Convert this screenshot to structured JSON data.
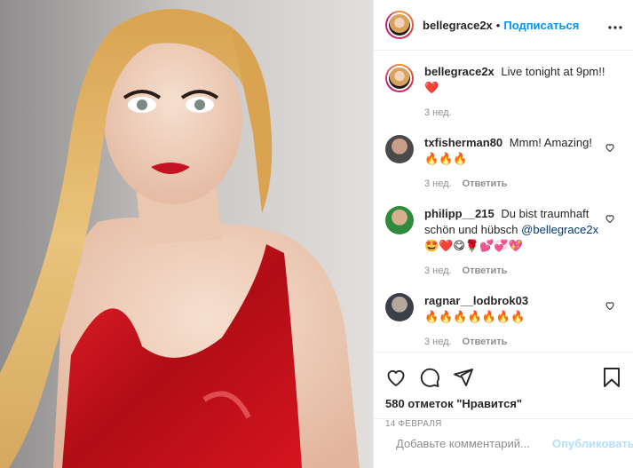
{
  "colors": {
    "accent": "#0095f6",
    "muted": "#8e8e8e",
    "heart": "#ed4956"
  },
  "header": {
    "username": "bellegrace2x",
    "separator": "•",
    "follow_label": "Подписаться",
    "more_icon": "more-options-icon"
  },
  "caption": {
    "username": "bellegrace2x",
    "text": "Live tonight at 9pm!!",
    "emoji": "❤️",
    "time": "3 нед."
  },
  "comments": [
    {
      "username": "txfisherman80",
      "text": "Mmm! Amazing!",
      "emoji": "🔥🔥🔥",
      "time": "3 нед.",
      "reply_label": "Ответить"
    },
    {
      "username": "philipp__215",
      "text": "Du bist traumhaft schön und hübsch",
      "mention": "@bellegrace2x",
      "emoji": "🤩❤️😋🌹💕💞💖",
      "time": "3 нед.",
      "reply_label": "Ответить"
    },
    {
      "username": "ragnar__lodbrok03",
      "text": "",
      "emoji": "🔥🔥🔥🔥🔥🔥🔥",
      "time": "3 нед.",
      "reply_label": "Ответить"
    }
  ],
  "actions": {
    "like_icon": "heart-outline-icon",
    "comment_icon": "comment-icon",
    "share_icon": "share-icon",
    "save_icon": "bookmark-icon"
  },
  "likes_text": "580 отметок \"Нравится\"",
  "date": "14 февраля",
  "add_comment": {
    "placeholder": "Добавьте комментарий...",
    "publish_label": "Опубликовать",
    "emoji_icon": "emoji-smile-icon"
  }
}
